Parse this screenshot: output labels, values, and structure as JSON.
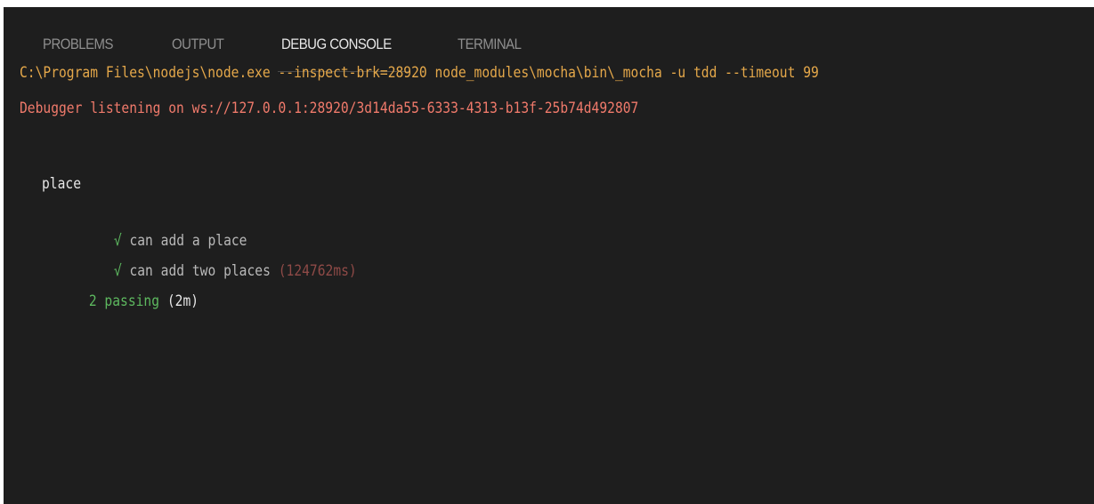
{
  "tabs": [
    {
      "label": "PROBLEMS"
    },
    {
      "label": "OUTPUT"
    },
    {
      "label": "DEBUG CONSOLE"
    },
    {
      "label": "TERMINAL"
    }
  ],
  "active_tab": "DEBUG CONSOLE",
  "console": {
    "command": "C:\\Program Files\\nodejs\\node.exe --inspect-brk=28920 node_modules\\mocha\\bin\\_mocha -u tdd --timeout 99",
    "debugger": "Debugger listening on ws://127.0.0.1:28920/3d14da55-6333-4313-b13f-25b74d492807",
    "suite": "place",
    "tests": [
      {
        "check": "√",
        "name": "can add a place",
        "duration": ""
      },
      {
        "check": "√",
        "name": "can add two places",
        "duration": "(124762ms)"
      }
    ],
    "summary": {
      "passing": "2 passing",
      "time": "(2m)"
    }
  },
  "colors": {
    "background": "#1e1e1e",
    "command": "#e5a84a",
    "debugger": "#f07a6b",
    "pass": "#5db85f",
    "slow": "#8f4a47"
  }
}
